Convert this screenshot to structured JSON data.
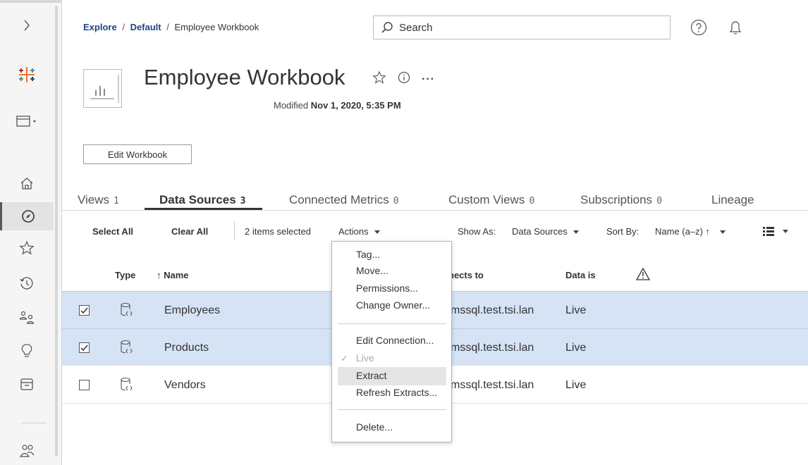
{
  "breadcrumb": {
    "explore": "Explore",
    "separator": "/",
    "default": "Default",
    "current": "Employee Workbook"
  },
  "search": {
    "placeholder": "Search"
  },
  "workbook": {
    "title": "Employee Workbook",
    "modified_label": "Modified",
    "modified_value": "Nov 1, 2020, 5:35 PM",
    "edit_button": "Edit Workbook",
    "more_label": "···"
  },
  "tabs": [
    {
      "label": "Views",
      "count": "1"
    },
    {
      "label": "Data Sources",
      "count": "3"
    },
    {
      "label": "Connected Metrics",
      "count": "0"
    },
    {
      "label": "Custom Views",
      "count": "0"
    },
    {
      "label": "Subscriptions",
      "count": "0"
    },
    {
      "label": "Lineage",
      "count": ""
    }
  ],
  "toolbar": {
    "select_all": "Select All",
    "clear_all": "Clear All",
    "selected_count": "2 items selected",
    "actions": "Actions",
    "show_as_label": "Show As:",
    "show_as_value": "Data Sources",
    "sort_by_label": "Sort By:",
    "sort_by_value": "Name (a–z) ↑"
  },
  "table": {
    "headers": {
      "type": "Type",
      "name": "↑ Name",
      "connects_to": "nects to",
      "data_is": "Data is"
    },
    "rows": [
      {
        "name": "Employees",
        "connects_to": "mssql.test.tsi.lan",
        "data_is": "Live",
        "selected": true
      },
      {
        "name": "Products",
        "connects_to": "mssql.test.tsi.lan",
        "data_is": "Live",
        "selected": true
      },
      {
        "name": "Vendors",
        "connects_to": "mssql.test.tsi.lan",
        "data_is": "Live",
        "selected": false
      }
    ]
  },
  "menu": {
    "items": [
      {
        "label": "Tag...",
        "enabled": true
      },
      {
        "label": "Move...",
        "enabled": true
      },
      {
        "label": "Permissions...",
        "enabled": true
      },
      {
        "label": "Change Owner...",
        "enabled": true
      },
      {
        "label": "Edit Connection...",
        "enabled": true
      },
      {
        "label": "Live",
        "enabled": false,
        "checked": true
      },
      {
        "label": "Extract",
        "enabled": true,
        "highlighted": true
      },
      {
        "label": "Refresh Extracts...",
        "enabled": true
      },
      {
        "label": "Delete...",
        "enabled": true
      }
    ],
    "check_mark": "✓"
  },
  "colors": {
    "selected_row": "#d5e3f5",
    "link": "#1f457e",
    "menu_highlight": "#e5e5e5"
  },
  "icons": {
    "sidebar": [
      "expand-icon",
      "tableau-logo-icon",
      "site-switcher-icon",
      "home-icon",
      "explore-icon",
      "favorites-icon",
      "recents-icon",
      "shared-with-me-icon",
      "recommendations-icon",
      "collections-icon",
      "users-icon"
    ],
    "header": [
      "search-icon",
      "help-icon",
      "notifications-icon"
    ],
    "workbook": [
      "workbook-thumbnail-icon",
      "star-icon",
      "info-icon",
      "more-icon"
    ],
    "toolbar": [
      "list-view-icon"
    ],
    "table": [
      "warning-icon",
      "data-source-icon",
      "checkbox-checked-icon"
    ]
  }
}
